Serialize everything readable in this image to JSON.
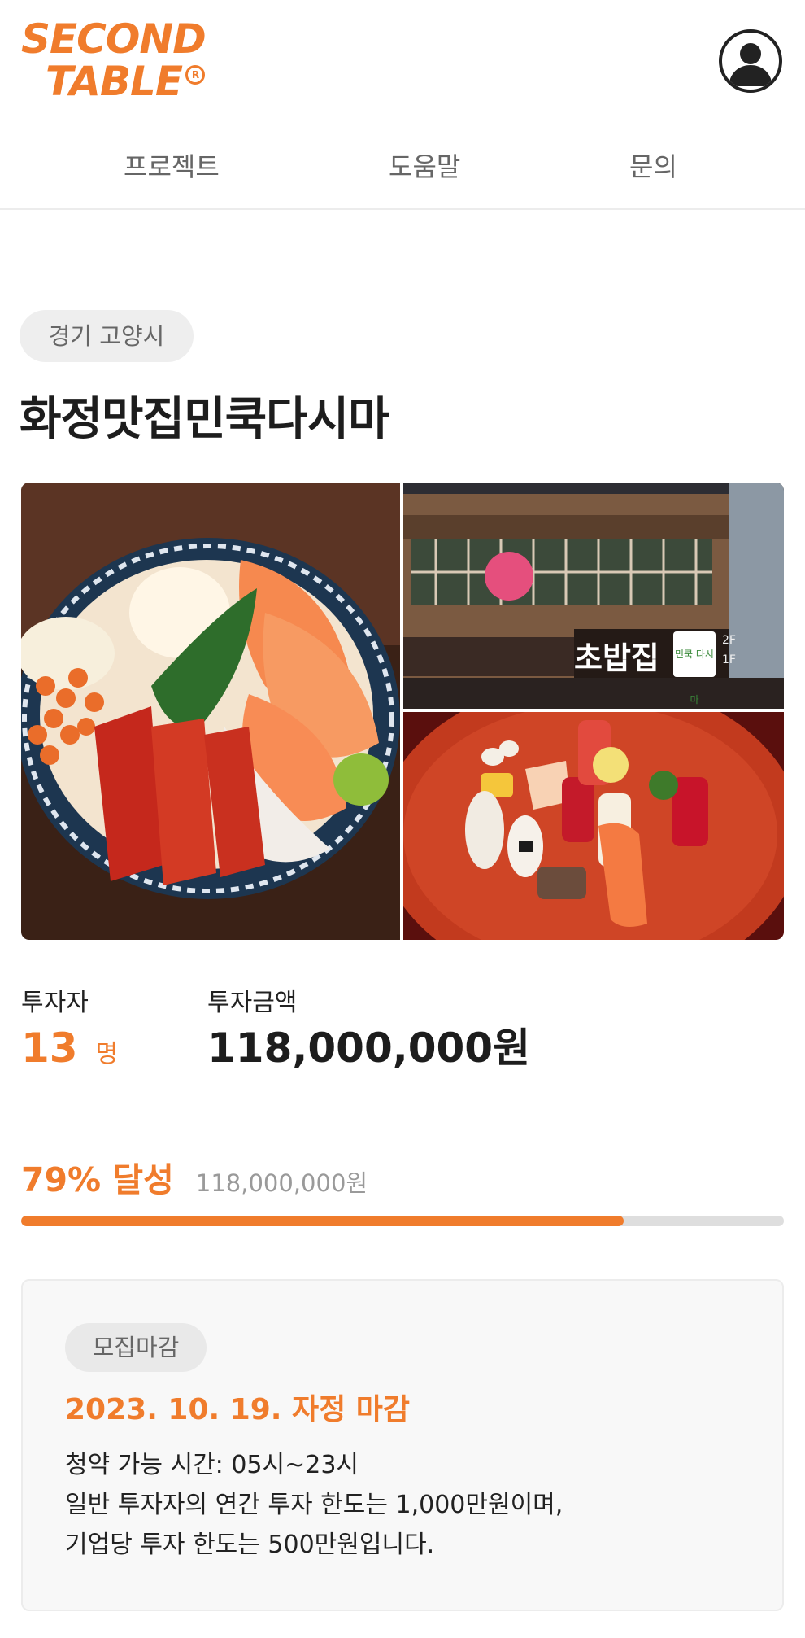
{
  "brand": {
    "line1": "SECOND",
    "line2": "TABLE",
    "mark": "R"
  },
  "nav": {
    "items": [
      "프로젝트",
      "도움말",
      "문의"
    ]
  },
  "project": {
    "location": "경기 고양시",
    "name": "화정맛집민쿡다시마",
    "photos": {
      "storefront_sign_main": "초밥집",
      "storefront_sign_brand": "민쿡 다시마",
      "storefront_floor_top": "2F",
      "storefront_floor_bottom": "1F"
    }
  },
  "stats": {
    "investors_label": "투자자",
    "investors_count": "13",
    "investors_unit": "명",
    "amount_label": "투자금액",
    "amount_value": "118,000,000원"
  },
  "progress": {
    "percent_text": "79% 달성",
    "amount_text": "118,000,000원",
    "fraction": 0.79
  },
  "notice": {
    "badge": "모집마감",
    "deadline": "2023. 10. 19. 자정 마감",
    "lines": [
      "청약 가능 시간: 05시~23시",
      "일반 투자자의 연간 투자 한도는 1,000만원이며,",
      "기업당 투자 한도는 500만원입니다."
    ]
  },
  "colors": {
    "accent": "#f07c2c",
    "track": "#dedede",
    "chip_bg": "#eeeeee"
  },
  "icons": {
    "profile": "user-avatar-icon"
  }
}
